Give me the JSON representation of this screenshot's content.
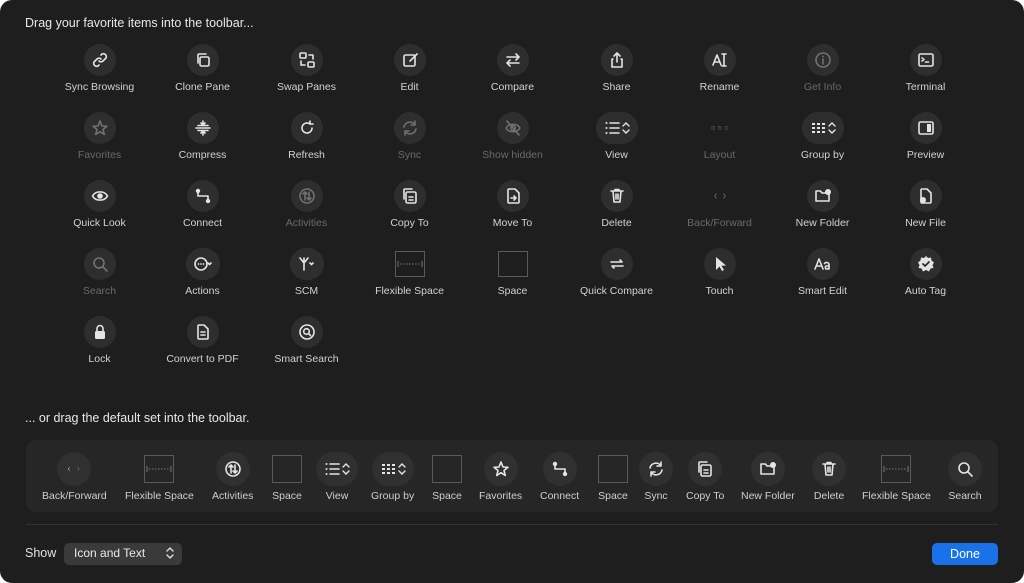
{
  "heading_top": "Drag your favorite items into the toolbar...",
  "heading_default": "... or drag the default set into the toolbar.",
  "palette": [
    [
      "Sync Browsing",
      "Clone Pane",
      "Swap Panes",
      "Edit",
      "Compare",
      "Share",
      "Rename",
      "Get Info",
      "Terminal"
    ],
    [
      "Favorites",
      "Compress",
      "Refresh",
      "Sync",
      "Show hidden",
      "View",
      "Layout",
      "Group by",
      "Preview"
    ],
    [
      "Quick Look",
      "Connect",
      "Activities",
      "Copy To",
      "Move To",
      "Delete",
      "Back/Forward",
      "New Folder",
      "New File"
    ],
    [
      "Search",
      "Actions",
      "SCM",
      "Flexible Space",
      "Space",
      "Quick Compare",
      "Touch",
      "Smart Edit",
      "Auto Tag"
    ],
    [
      "Lock",
      "Convert to PDF",
      "Smart Search"
    ]
  ],
  "palette_icons": [
    [
      "link-icon",
      "clone-icon",
      "swap-icon",
      "edit-icon",
      "compare-icon",
      "share-icon",
      "rename-icon",
      "info-icon",
      "terminal-icon"
    ],
    [
      "star-icon",
      "compress-icon",
      "refresh-icon",
      "sync-icon",
      "eye-slash-icon",
      "list-icon",
      "layout-icon",
      "grid-icon",
      "preview-icon"
    ],
    [
      "eye-icon",
      "connect-icon",
      "activities-icon",
      "copy-icon",
      "move-icon",
      "trash-icon",
      "back-forward-icon",
      "new-folder-icon",
      "new-file-icon"
    ],
    [
      "search-icon",
      "ellipsis-icon",
      "branch-icon",
      "flexible-space-icon",
      "space-icon",
      "quick-compare-icon",
      "pointer-icon",
      "text-aa-icon",
      "badge-check-icon"
    ],
    [
      "lock-icon",
      "pdf-icon",
      "smart-search-icon"
    ]
  ],
  "palette_disabled": [
    "Get Info",
    "Favorites",
    "Sync",
    "Show hidden",
    "Layout",
    "Activities",
    "Back/Forward",
    "Search"
  ],
  "default_set": [
    "Back/Forward",
    "Flexible Space",
    "Activities",
    "Space",
    "View",
    "Group by",
    "Space",
    "Favorites",
    "Connect",
    "Space",
    "Sync",
    "Copy To",
    "New Folder",
    "Delete",
    "Flexible Space",
    "Search"
  ],
  "default_icons": [
    "back-forward-icon",
    "flexible-space-icon",
    "activities-icon",
    "space-icon",
    "list-icon",
    "grid-icon",
    "space-icon",
    "star-icon",
    "connect-icon",
    "space-icon",
    "sync-icon",
    "copy-icon",
    "new-folder-icon",
    "trash-icon",
    "flexible-space-icon",
    "search-icon"
  ],
  "footer": {
    "show_label": "Show",
    "show_value": "Icon and Text",
    "done_label": "Done"
  },
  "colors": {
    "background": "#1e1e1e",
    "accent": "#1a72e8"
  }
}
